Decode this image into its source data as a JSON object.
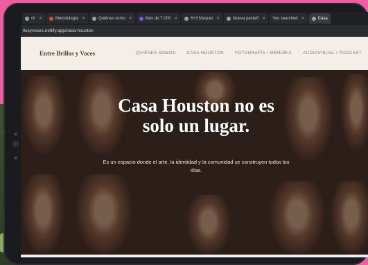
{
  "browser": {
    "tabs": [
      {
        "label": "cti",
        "favicon_color": "#9aa0a6"
      },
      {
        "label": "Metodología",
        "favicon_color": "#e0463a"
      },
      {
        "label": "Quiénes somo",
        "favicon_color": "#9aa0a6"
      },
      {
        "label": "Más de 7.000",
        "favicon_color": "#7b5cd6"
      },
      {
        "label": "6+3 Maquet",
        "favicon_color": "#9aa0a6"
      },
      {
        "label": "Nueva pestañ",
        "favicon_color": "#9aa0a6"
      },
      {
        "label": "You searched",
        "favicon_color": "#9aa0a6"
      },
      {
        "label": "Casa",
        "favicon_color": "#9aa0a6"
      }
    ],
    "url": "llosyvoces.netlify.app/casa-houston"
  },
  "site": {
    "brand": "Entre Brillos y Voces",
    "nav": [
      "QUIÉNES SOMOS",
      "CASA HOUSTON",
      "FOTOGRAFÍA / MEMORIA",
      "AUDIOVISUAL / PODCAST"
    ]
  },
  "hero": {
    "title_line1": "Casa Houston no es",
    "title_line2": "solo un lugar.",
    "subtitle": "Es un espacio donde el arte, la identidad y la comunidad se construyen todos los días."
  },
  "colors": {
    "backdrop": "#ec5fa3",
    "header_bg": "#f4eee8",
    "brand_text": "#5a3f2e"
  }
}
